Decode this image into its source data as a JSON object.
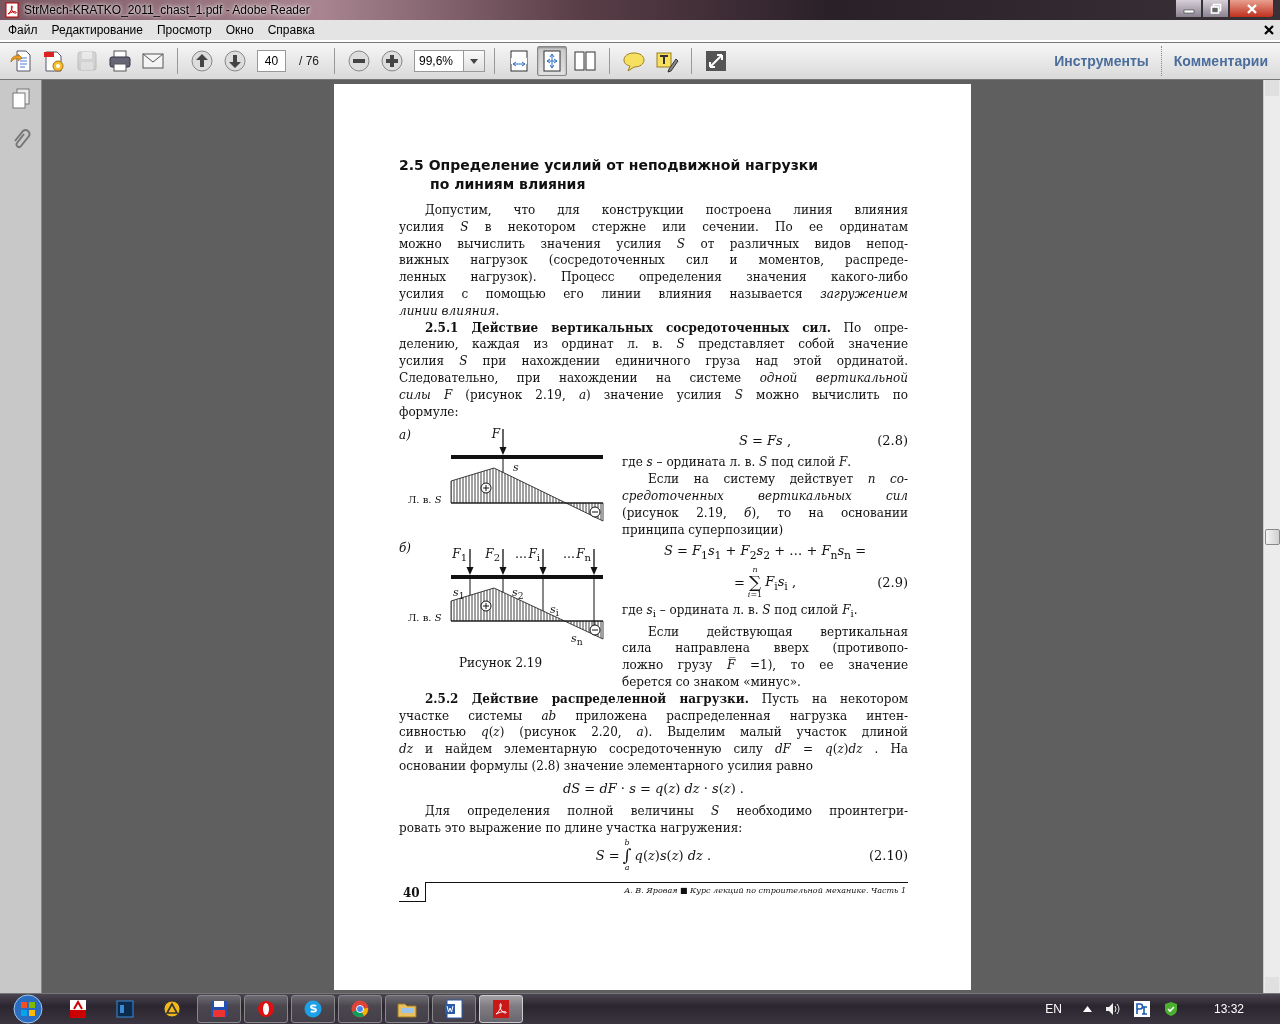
{
  "window": {
    "title": "StrMech-KRATKO_2011_chast_1.pdf - Adobe Reader"
  },
  "menu": [
    "Файл",
    "Редактирование",
    "Просмотр",
    "Окно",
    "Справка"
  ],
  "toolbar": {
    "groups": [
      [
        {
          "kind": "create",
          "disabled": false,
          "selected": false
        },
        {
          "kind": "settings",
          "disabled": false,
          "selected": false
        },
        {
          "kind": "save",
          "disabled": true,
          "selected": false
        },
        {
          "kind": "print",
          "disabled": false,
          "selected": false
        },
        {
          "kind": "mail",
          "disabled": false,
          "selected": false
        }
      ],
      [
        {
          "kind": "prev",
          "disabled": false,
          "selected": false
        },
        {
          "kind": "next",
          "disabled": false,
          "selected": false
        },
        {
          "kind": "page",
          "value": "40",
          "total": "/ 76"
        }
      ],
      [
        {
          "kind": "minus",
          "disabled": false,
          "selected": false
        },
        {
          "kind": "plus",
          "disabled": false,
          "selected": false
        },
        {
          "kind": "zoom",
          "value": "99,6%"
        }
      ],
      [
        {
          "kind": "fit-width",
          "disabled": false,
          "selected": false
        },
        {
          "kind": "fit-page",
          "disabled": false,
          "selected": true
        },
        {
          "kind": "two-up",
          "disabled": false,
          "selected": false
        }
      ],
      [
        {
          "kind": "comment",
          "disabled": false,
          "selected": false
        },
        {
          "kind": "highlight",
          "disabled": false,
          "selected": false
        }
      ],
      [
        {
          "kind": "fullscreen",
          "disabled": false,
          "selected": false
        }
      ]
    ],
    "panels": [
      "Инструменты",
      "Комментарии"
    ]
  },
  "page": {
    "heading": [
      "2.5 Определение усилий от неподвижной нагрузки",
      "по линиям влияния"
    ],
    "intro": [
      {
        "kind": "para",
        "lines": [
          "Допустим, что для конструкции построена линия влияния",
          "усилия *S* в некотором стержне или сечении. По ее ординатам",
          "можно вычислить значения усилия *S* от различных видов непод-",
          "вижных нагрузок (сосредоточенных сил и моментов, распреде-",
          "ленных нагрузок). Процесс определения значения какого-либо",
          "усилия с помощью его линии влияния называется *загружением*",
          "*линии влияния*."
        ]
      },
      {
        "kind": "para",
        "lines": [
          "**2.5.1 Действие вертикальных сосредоточенных сил.**  По опре-",
          "делению, каждая из ординат л. в. *S* представляет собой значение",
          "усилия *S* при нахождении единичного груза над этой ординатой.",
          "Следовательно, при нахождении на системе *одной вертикальной*",
          "*силы F* (рисунок 2.19, *а*) значение усилия *S* можно вычислить по",
          "формуле:"
        ]
      }
    ],
    "figure": {
      "panels": [
        {
          "label": "а)",
          "axis_label": "Л. в. *S*",
          "forces": [
            {
              "label": "*F*",
              "arrow": true
            }
          ],
          "ordinates": [
            "*s*"
          ]
        },
        {
          "label": "б)",
          "axis_label": "Л. в. *S*",
          "forces": [
            {
              "label": "*F*$_{1}$",
              "arrow": true
            },
            {
              "label": "*F*$_{2}$",
              "arrow": true
            },
            {
              "label": "…",
              "arrow": false
            },
            {
              "label": "*F*$_{i}$",
              "arrow": true
            },
            {
              "label": "…",
              "arrow": false
            },
            {
              "label": "*F*$_{n}$",
              "arrow": true
            }
          ],
          "ordinates": [
            "*s*$_{1}$",
            "*s*$_{2}$",
            "*s*$_{i}$",
            "*s*$_{n}$"
          ]
        }
      ],
      "caption": "Рисунок 2.19"
    },
    "side": [
      {
        "kind": "formula",
        "text": "*S* = *Fs* ,",
        "number": "(2.8)"
      },
      {
        "kind": "cont",
        "lines": [
          "где *s* – ордината л. в. *S* под силой *F*."
        ]
      },
      {
        "kind": "para",
        "lines": [
          "Если на систему действует *n со-*",
          "*средоточенных вертикальных сил*",
          "(рисунок 2.19, *б*), то на основании",
          "принципа суперпозиции)"
        ]
      },
      {
        "kind": "formula",
        "text": "*S* = *F*$_{1}$*s*$_{1}$ + *F*$_{2}$*s*$_{2}$ + … + *F*$_{n}$*s*$_{n}$ ="
      },
      {
        "kind": "sum",
        "lead": "=",
        "symbol": "∑",
        "upper": "*n*",
        "lower": "*i*=1",
        "body": "*F*$_{i}$*s*$_{i}$ ,",
        "number": "(2.9)"
      },
      {
        "kind": "cont",
        "lines": [
          "где *s*$_{i}$ – ордината л. в. *S* под силой *F*$_{i}$."
        ]
      },
      {
        "kind": "para",
        "lines": [
          "Если действующая вертикальная",
          "сила направлена вверх (противопо-",
          "ложно грузу *F̅* =1), то ее значение",
          "берется со знаком «минус»."
        ]
      }
    ],
    "after": [
      {
        "kind": "para",
        "lines": [
          "**2.5.2 Действие распределенной нагрузки.** Пусть на некотором",
          "участке системы *ab* приложена распределенная нагрузка интен-",
          "сивностью *q*(*z*) (рисунок 2.20, *а*). Выделим малый участок длиной",
          "*dz* и найдем элементарную сосредоточенную силу *dF* = *q*(*z*)*dz* . На",
          "основании формулы (2.8) значение элементарного усилия равно"
        ]
      },
      {
        "kind": "formula",
        "text": "*dS* = *dF* · *s* = *q*(*z*) *dz* · *s*(*z*) ."
      },
      {
        "kind": "para",
        "lines": [
          "Для определения полной величины *S* необходимо проинтегри-",
          "ровать это выражение по длине участка нагружения:"
        ]
      },
      {
        "kind": "sum",
        "lead": "*S* =",
        "symbol": "∫",
        "upper": "*b*",
        "lower": "*a*",
        "body": "*q*(*z*)*s*(*z*) *dz* .",
        "number": "(2.10)"
      }
    ],
    "footer": {
      "page_number": "40",
      "credit": "А. В. Яровая ■ Курс лекций по строительной механике. Часть 1"
    }
  },
  "taskbar": {
    "apps": [
      {
        "kind": "acrobat",
        "running": false,
        "selected": false
      },
      {
        "kind": "photoshop",
        "running": false,
        "selected": false
      },
      {
        "kind": "aimp",
        "running": false,
        "selected": false
      },
      {
        "kind": "floppy",
        "running": true,
        "selected": false
      },
      {
        "kind": "opera",
        "running": true,
        "selected": false
      },
      {
        "kind": "skype",
        "running": true,
        "selected": false
      },
      {
        "kind": "chrome",
        "running": true,
        "selected": false
      },
      {
        "kind": "explorer",
        "running": true,
        "selected": false
      },
      {
        "kind": "word",
        "running": true,
        "selected": false
      },
      {
        "kind": "reader",
        "running": true,
        "selected": true
      }
    ],
    "language": "EN",
    "clock": "13:32"
  }
}
